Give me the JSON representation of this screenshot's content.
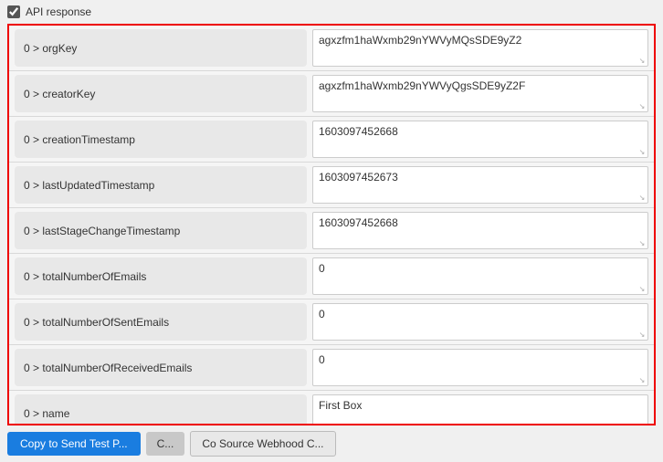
{
  "topBar": {
    "checkboxChecked": true,
    "label": "API response"
  },
  "fields": [
    {
      "key": "0 > orgKey",
      "value": "agxzfm1haWxmb29nYWVyMQsSDE9yZ2",
      "hasScrollbar": true
    },
    {
      "key": "0 > creatorKey",
      "value": "agxzfm1haWxmb29nYWVyQgsSDE9yZ2F",
      "hasScrollbar": true
    },
    {
      "key": "0 > creationTimestamp",
      "value": "1603097452668",
      "hasScrollbar": false
    },
    {
      "key": "0 > lastUpdatedTimestamp",
      "value": "1603097452673",
      "hasScrollbar": false
    },
    {
      "key": "0 > lastStageChangeTimestamp",
      "value": "1603097452668",
      "hasScrollbar": false
    },
    {
      "key": "0 > totalNumberOfEmails",
      "value": "0",
      "hasScrollbar": false
    },
    {
      "key": "0 > totalNumberOfSentEmails",
      "value": "0",
      "hasScrollbar": false
    },
    {
      "key": "0 > totalNumberOfReceivedEmails",
      "value": "0",
      "hasScrollbar": false
    },
    {
      "key": "0 > name",
      "value": "First Box",
      "hasScrollbar": false
    }
  ],
  "buttons": {
    "primary": "Copy to Send Test P...",
    "secondary": "C...",
    "tertiary": "Co Source Webhood C..."
  }
}
